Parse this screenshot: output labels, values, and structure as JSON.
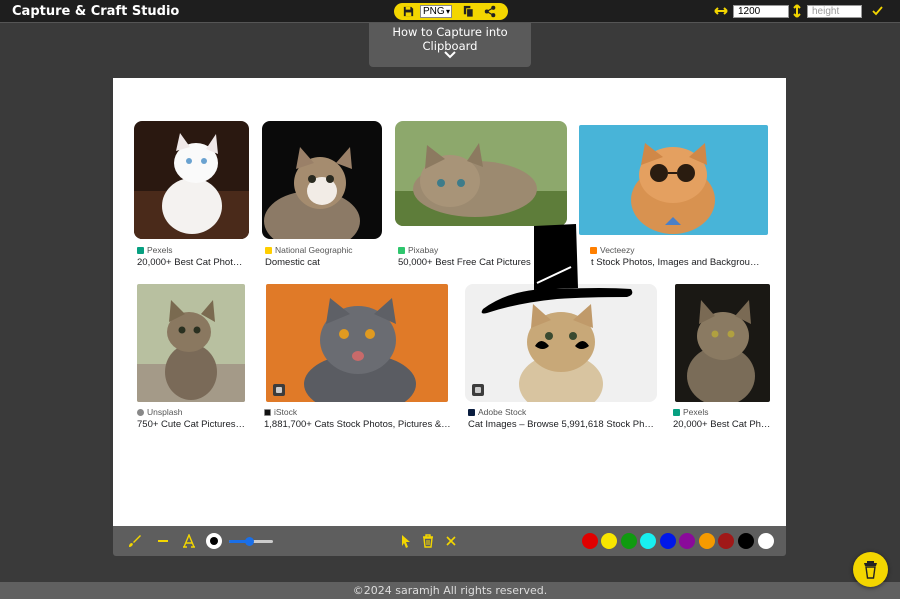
{
  "app": {
    "title": "Capture & Craft Studio"
  },
  "toolbar_top": {
    "format_value": "PNG",
    "width_value": "1200",
    "height_placeholder": "height",
    "accent_color": "#f3d600"
  },
  "guide": {
    "text": "How to Capture into Clipboard"
  },
  "results": [
    {
      "source": "Pexels",
      "caption": "20,000+ Best Cat Phot…",
      "favicon_color": "#07a081"
    },
    {
      "source": "National Geographic",
      "caption": "Domestic cat",
      "favicon_color": "#ffce00"
    },
    {
      "source": "Pixabay",
      "caption": "50,000+ Best Free Cat Pictures",
      "favicon_color": "#2ec66d"
    },
    {
      "source": "Vecteezy",
      "caption": "t Stock Photos, Images and Backgrou…",
      "favicon_color": "#ff7f00"
    },
    {
      "source": "Unsplash",
      "caption": "750+ Cute Cat Pictures…",
      "favicon_color": "#888888"
    },
    {
      "source": "iStock",
      "caption": "1,881,700+ Cats Stock Photos, Pictures &…",
      "favicon_color": "#111111"
    },
    {
      "source": "Adobe Stock",
      "caption": "Cat Images – Browse 5,991,618 Stock Ph…",
      "favicon_color": "#0a1d3f"
    },
    {
      "source": "Pexels",
      "caption": "20,000+ Best Cat Ph…",
      "favicon_color": "#07a081"
    }
  ],
  "palette": [
    "#e00000",
    "#f7e600",
    "#109a10",
    "#18f0f0",
    "#0018e8",
    "#8a0a9a",
    "#f59a00",
    "#a01818",
    "#000000",
    "#ffffff"
  ],
  "icons": {
    "save": "save-icon",
    "copy": "copy-icon",
    "share": "share-icon",
    "brush": "brush-icon",
    "line": "line-icon",
    "text": "text-icon",
    "cursor": "cursor-icon",
    "trash": "trash-icon",
    "close": "close-icon",
    "coffee": "coffee-cup-icon"
  },
  "footer": {
    "text": "©2024 saramjh All rights reserved."
  }
}
